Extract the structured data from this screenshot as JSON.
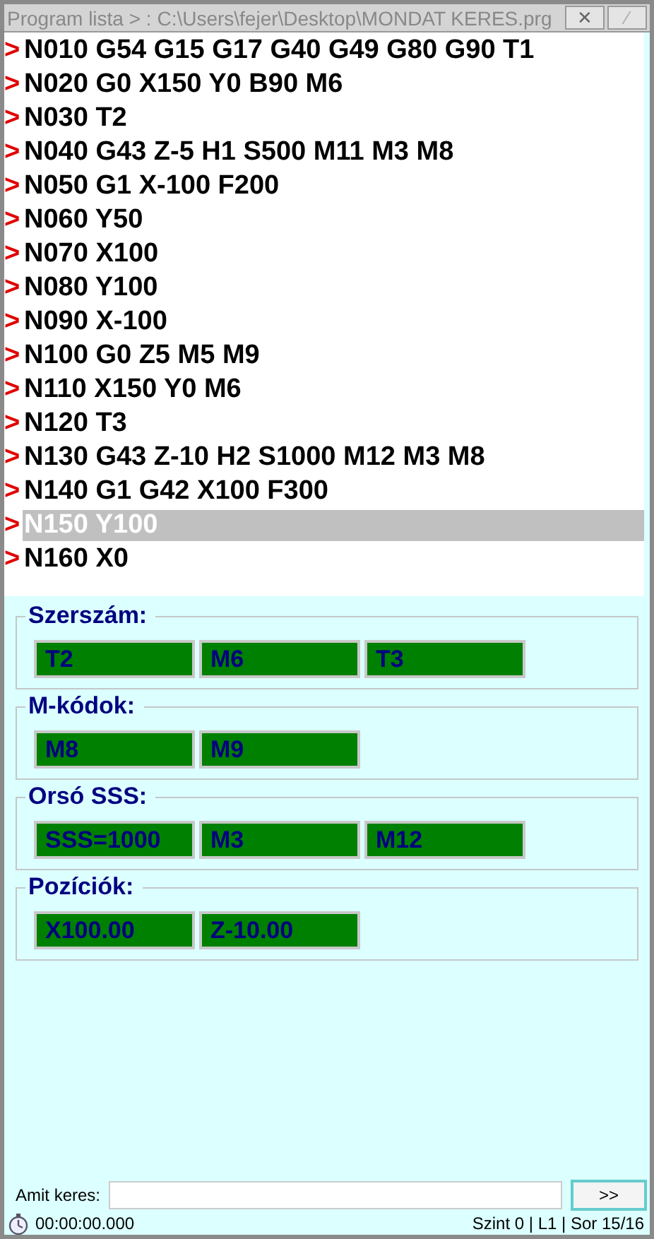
{
  "window": {
    "title": "Program lista > : C:\\Users\\fejer\\Desktop\\MONDAT KERES.prg",
    "close": "✕",
    "edit": "⁄"
  },
  "program": {
    "marker": ">",
    "lines": [
      {
        "text": "N010 G54 G15 G17 G40 G49 G80 G90 T1",
        "selected": false
      },
      {
        "text": "N020 G0 X150 Y0 B90 M6",
        "selected": false
      },
      {
        "text": "N030 T2",
        "selected": false
      },
      {
        "text": "N040 G43 Z-5 H1 S500 M11 M3 M8",
        "selected": false
      },
      {
        "text": "N050 G1 X-100 F200",
        "selected": false
      },
      {
        "text": "N060 Y50",
        "selected": false
      },
      {
        "text": "N070 X100",
        "selected": false
      },
      {
        "text": "N080 Y100",
        "selected": false
      },
      {
        "text": "N090 X-100",
        "selected": false
      },
      {
        "text": "N100 G0 Z5 M5 M9",
        "selected": false
      },
      {
        "text": "N110 X150 Y0 M6",
        "selected": false
      },
      {
        "text": "N120 T3",
        "selected": false
      },
      {
        "text": "N130 G43 Z-10 H2 S1000 M12 M3 M8",
        "selected": false
      },
      {
        "text": "N140 G1 G42 X100 F300",
        "selected": false
      },
      {
        "text": "N150 Y100",
        "selected": true
      },
      {
        "text": "N160 X0",
        "selected": false
      }
    ]
  },
  "groups": [
    {
      "title": "Szerszám:",
      "values": [
        "T2",
        "M6",
        "T3"
      ]
    },
    {
      "title": "M-kódok:",
      "values": [
        "M8",
        "M9"
      ]
    },
    {
      "title": "Orsó SSS:",
      "values": [
        "SSS=1000",
        "M3",
        "M12"
      ]
    },
    {
      "title": "Pozíciók:",
      "values": [
        "X100.00",
        "Z-10.00"
      ]
    }
  ],
  "search": {
    "label": "Amit keres:",
    "button": ">>"
  },
  "status_bar": {
    "timer": "00:00:00.000",
    "position": "Szint 0 | L1 | Sor 15/16"
  }
}
